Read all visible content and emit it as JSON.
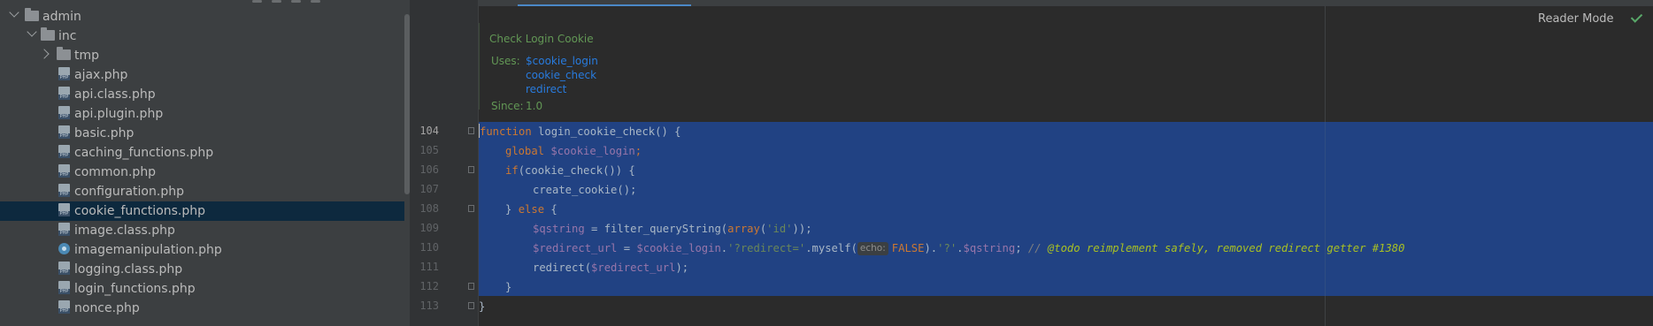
{
  "project_tree": {
    "items": [
      {
        "label": "admin",
        "icon": "folder-icon",
        "expanded": true
      },
      {
        "label": "inc",
        "icon": "folder-icon",
        "expanded": true
      },
      {
        "label": "tmp",
        "icon": "folder-icon",
        "expanded": false
      },
      {
        "label": "ajax.php",
        "icon": "php-file-icon"
      },
      {
        "label": "api.class.php",
        "icon": "php-file-icon"
      },
      {
        "label": "api.plugin.php",
        "icon": "php-file-icon"
      },
      {
        "label": "basic.php",
        "icon": "php-file-icon"
      },
      {
        "label": "caching_functions.php",
        "icon": "php-file-icon"
      },
      {
        "label": "common.php",
        "icon": "php-file-icon"
      },
      {
        "label": "configuration.php",
        "icon": "php-file-icon"
      },
      {
        "label": "cookie_functions.php",
        "icon": "php-file-icon",
        "selected": true
      },
      {
        "label": "image.class.php",
        "icon": "php-file-icon"
      },
      {
        "label": "imagemanipulation.php",
        "icon": "class-icon"
      },
      {
        "label": "logging.class.php",
        "icon": "php-file-icon"
      },
      {
        "label": "login_functions.php",
        "icon": "php-file-icon"
      },
      {
        "label": "nonce.php",
        "icon": "php-file-icon"
      }
    ]
  },
  "editor": {
    "reader_mode_label": "Reader Mode",
    "doc_popup": {
      "title": "Check Login Cookie",
      "uses_label": "Uses:",
      "uses": [
        "$cookie_login",
        "cookie_check",
        "redirect"
      ],
      "since_label": "Since:",
      "since_value": "1.0"
    },
    "line_numbers": [
      "104",
      "105",
      "106",
      "107",
      "108",
      "109",
      "110",
      "111",
      "112",
      "113"
    ],
    "code": {
      "l104_kw": "function",
      "l104_rest": " login_cookie_check() {",
      "l105_kw": "global",
      "l105_var": "$cookie_login",
      "l105_end": ";",
      "l106_kw": "if",
      "l106_rest": "(cookie_check()) {",
      "l107": "create_cookie();",
      "l108_a": "} ",
      "l108_kw": "else",
      "l108_b": " {",
      "l109_var": "$qstring",
      "l109_a": " = filter_queryString(",
      "l109_kw": "array",
      "l109_b": "(",
      "l109_str": "'id'",
      "l109_c": "));",
      "l110_var": "$redirect_url",
      "l110_a": " = ",
      "l110_var2": "$cookie_login",
      "l110_b": ".",
      "l110_str": "'?redirect='",
      "l110_c": ".myself(",
      "l110_hint": "echo:",
      "l110_kw": "FALSE",
      "l110_d": ").",
      "l110_str2": "'?'",
      "l110_e": ".",
      "l110_var3": "$qstring",
      "l110_f": "; ",
      "l110_cmt": "// ",
      "l110_todo": "@todo reimplement safely, removed redirect getter #1380",
      "l111_a": "redirect(",
      "l111_var": "$redirect_url",
      "l111_b": ");",
      "l112": "}",
      "l113": "}"
    }
  },
  "colors": {
    "selection": "#214283",
    "doc_green": "#629755",
    "link_blue": "#287bde",
    "keyword": "#cc7832",
    "variable": "#9876aa",
    "string": "#6a8759"
  }
}
